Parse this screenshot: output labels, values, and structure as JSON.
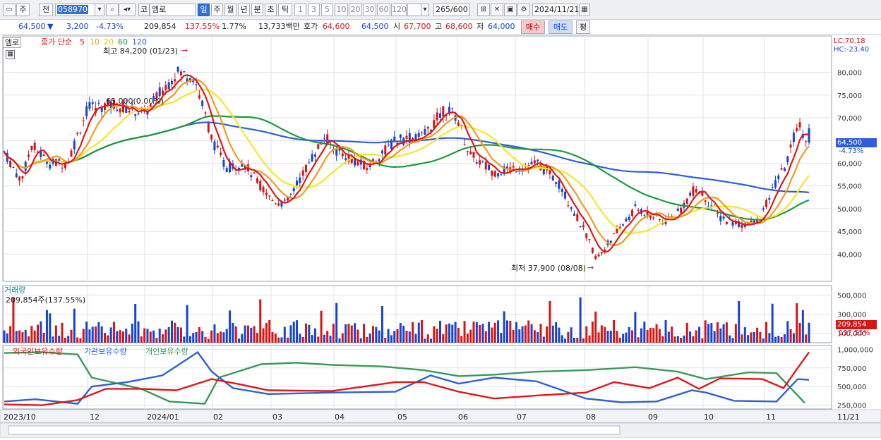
{
  "toolbar": {
    "mode_buttons": [
      "주",
      "전"
    ],
    "stock_code": "058970",
    "market": "코",
    "stock_name": "엠로",
    "periods": [
      "일",
      "주",
      "월",
      "년",
      "분",
      "초",
      "틱"
    ],
    "active_period": "일",
    "minute_intervals": [
      "1",
      "3",
      "5",
      "10",
      "20",
      "30",
      "60",
      "120"
    ],
    "count": "265",
    "count_total": "/600",
    "date": "2024/11/21"
  },
  "quote": {
    "price": "64,500",
    "change": "3,200",
    "change_pct": "-4.73%",
    "volume": "209,854",
    "volume_ratio": "137.55%",
    "turnover": "1.77%",
    "amount": "13,733백만",
    "hoga_label": "호가",
    "ask": "64,600",
    "bid": "64,500",
    "open_label": "시",
    "open": "67,700",
    "high_label": "고",
    "high": "68,600",
    "low_label": "저",
    "low": "64,000",
    "buy_label": "매수",
    "sell_label": "매도",
    "avg_label": "평"
  },
  "colors": {
    "ma5": "#e01818",
    "ma10": "#f39a1e",
    "ma20": "#f2e82c",
    "ma60": "#1f9a3a",
    "ma120": "#2f5fd6",
    "up": "#d61515",
    "down": "#1544d6",
    "foreign": "#e01818",
    "institution": "#2f5fd6",
    "individual": "#3a9a5a"
  },
  "price_panel": {
    "name": "엠로",
    "legend_prefix": "종가 단순",
    "ma_periods": [
      "5",
      "10",
      "20",
      "60",
      "120"
    ],
    "hl_label": "최고 84,200 (01/23)",
    "low_note": "최저 37,900 (08/08)",
    "pct_note": "65,000(0.00%)",
    "lc": "LC:70.18",
    "hc": "HC:-23.40",
    "current_price": "64,500",
    "current_pct": "-4.73%"
  },
  "volume_panel": {
    "title": "거래량",
    "value_text": "209,854주(137.55%)",
    "current_value": "209,854",
    "current_pct": "137.55%"
  },
  "holdings_panel": {
    "legend": [
      "외국인보유수량",
      "기관보유수량",
      "개인보유수량"
    ]
  },
  "x_axis": {
    "labels": [
      "2023/10",
      "12",
      "2024/01",
      "02",
      "03",
      "04",
      "05",
      "06",
      "07",
      "08",
      "09",
      "10",
      "11",
      "11/21"
    ]
  },
  "chart_data": [
    {
      "type": "candlestick",
      "title": "엠로",
      "ylim": [
        34000,
        88000
      ],
      "y_ticks": [
        40000,
        45000,
        50000,
        55000,
        60000,
        65000,
        70000,
        75000,
        80000
      ],
      "y_tick_labels": [
        "40,000",
        "45,000",
        "50,000",
        "55,000",
        "60,000",
        "65,000",
        "70,000",
        "75,000",
        "80,000"
      ],
      "max_point": {
        "date": "01/23",
        "value": 84200
      },
      "min_point": {
        "date": "08/08",
        "value": 37900
      },
      "close_anchors": [
        {
          "date": "2023/10",
          "value": 62500
        },
        {
          "date": "2023/11",
          "value": 60000
        },
        {
          "date": "2023/12",
          "value": 72000
        },
        {
          "date": "2024/01",
          "value": 78000
        },
        {
          "date": "2024/02",
          "value": 60000
        },
        {
          "date": "2024/03",
          "value": 52000
        },
        {
          "date": "2024/04",
          "value": 63000
        },
        {
          "date": "2024/05",
          "value": 66000
        },
        {
          "date": "2024/06",
          "value": 70000
        },
        {
          "date": "2024/07",
          "value": 59000
        },
        {
          "date": "2024/08",
          "value": 40000
        },
        {
          "date": "2024/09",
          "value": 49000
        },
        {
          "date": "2024/10",
          "value": 52000
        },
        {
          "date": "2024/11",
          "value": 47000
        },
        {
          "date": "11/21",
          "value": 64500
        }
      ]
    },
    {
      "type": "bar",
      "title": "거래량",
      "ylim": [
        0,
        600000
      ],
      "y_ticks": [
        100000,
        300000,
        500000
      ],
      "y_tick_labels": [
        "100,000",
        "300,000",
        "500,000"
      ]
    },
    {
      "type": "line",
      "title": "보유수량",
      "ylim": [
        200000,
        1050000
      ],
      "y_ticks": [
        250000,
        500000,
        750000,
        1000000
      ],
      "y_tick_labels": [
        "250,000",
        "500,000",
        "750,000",
        "1,000,000"
      ]
    }
  ]
}
